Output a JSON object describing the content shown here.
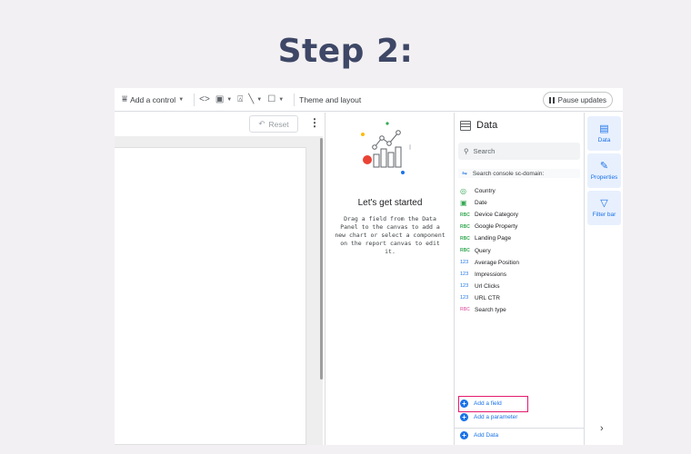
{
  "heading": "Step 2:",
  "toolbar": {
    "add_control": "Add a control",
    "theme_layout": "Theme and layout",
    "pause_updates": "Pause updates"
  },
  "canvas": {
    "reset_label": "Reset"
  },
  "started": {
    "title": "Let's get started",
    "description": "Drag a field from the Data Panel to the canvas to add a new chart or select a component on the report canvas to edit it."
  },
  "data_panel": {
    "title": "Data",
    "search_placeholder": "Search",
    "source": "Search console sc-domain:",
    "fields": [
      {
        "type": "geo",
        "badge": "◎",
        "label": "Country"
      },
      {
        "type": "date",
        "badge": "▣",
        "label": "Date"
      },
      {
        "type": "abc",
        "badge": "RBC",
        "label": "Device Category"
      },
      {
        "type": "abc",
        "badge": "RBC",
        "label": "Google Property"
      },
      {
        "type": "abc",
        "badge": "RBC",
        "label": "Landing Page"
      },
      {
        "type": "abc",
        "badge": "RBC",
        "label": "Query"
      },
      {
        "type": "num",
        "badge": "123",
        "label": "Average Position"
      },
      {
        "type": "num",
        "badge": "123",
        "label": "Impressions"
      },
      {
        "type": "num",
        "badge": "123",
        "label": "Url Clicks"
      },
      {
        "type": "num",
        "badge": "123",
        "label": "URL CTR"
      },
      {
        "type": "abc-pink",
        "badge": "RBC",
        "label": "Search type"
      }
    ],
    "add_field": "Add a field",
    "add_parameter": "Add a parameter",
    "add_data": "Add Data"
  },
  "rail": {
    "data": "Data",
    "properties": "Properties",
    "filter_bar": "Filter bar"
  },
  "colors": {
    "accent": "#1a73e8",
    "highlight_box": "#e31b6d",
    "heading": "#3e4766"
  }
}
